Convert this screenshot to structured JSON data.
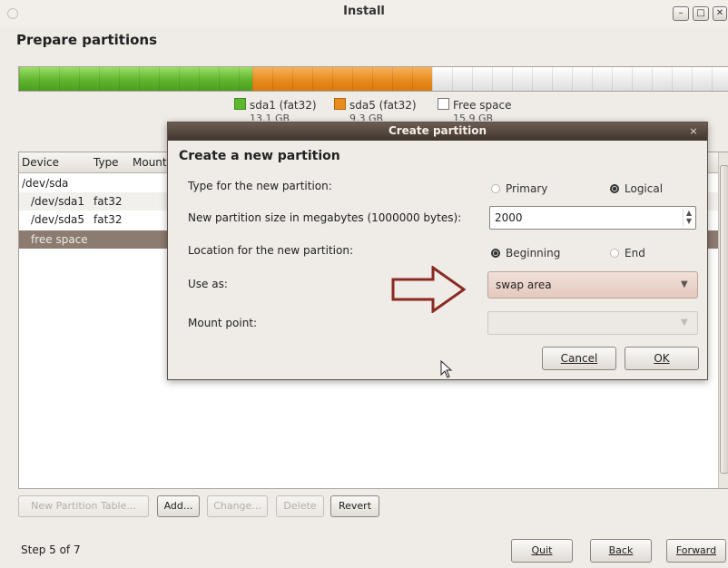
{
  "window": {
    "title": "Install",
    "controls": [
      "–",
      "□",
      "✕"
    ]
  },
  "page": {
    "title": "Prepare partitions"
  },
  "partition_bar": {
    "segments": [
      {
        "name": "sda1",
        "color": "#6cc23a"
      },
      {
        "name": "sda5",
        "color": "#e98c1e"
      },
      {
        "name": "free",
        "color": "#ececec"
      }
    ]
  },
  "legend": [
    {
      "label": "sda1 (fat32)",
      "size": "13.1 GB",
      "color": "#5cb82e"
    },
    {
      "label": "sda5 (fat32)",
      "size": "9.3 GB",
      "color": "#e98c1e"
    },
    {
      "label": "Free space",
      "size": "15.9 GB",
      "color": "#ffffff"
    }
  ],
  "table": {
    "headers": [
      "Device",
      "Type",
      "Mount"
    ],
    "rows": [
      {
        "device": "/dev/sda",
        "type": ""
      },
      {
        "device": "/dev/sda1",
        "type": "fat32"
      },
      {
        "device": "/dev/sda5",
        "type": "fat32"
      },
      {
        "device": "free space",
        "type": ""
      }
    ]
  },
  "buttons": {
    "new_table": "New Partition Table...",
    "add": "Add...",
    "change": "Change...",
    "delete": "Delete",
    "revert": "Revert",
    "quit": "Quit",
    "back": "Back",
    "forward": "Forward"
  },
  "step": "Step 5 of 7",
  "dialog": {
    "title": "Create partition",
    "close": "×",
    "heading": "Create a new partition",
    "type_label": "Type for the new partition:",
    "primary": "Primary",
    "logical": "Logical",
    "size_label": "New partition size in megabytes (1000000 bytes):",
    "size_value": "2000",
    "location_label": "Location for the new partition:",
    "beginning": "Beginning",
    "end": "End",
    "use_as_label": "Use as:",
    "use_as_value": "swap area",
    "mount_label": "Mount point:",
    "cancel": "Cancel",
    "ok": "OK"
  }
}
